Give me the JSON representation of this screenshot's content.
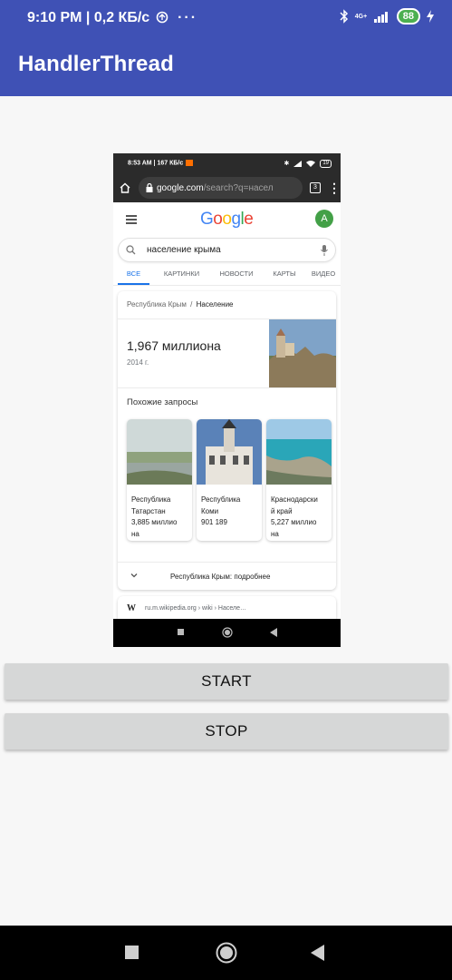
{
  "status_bar": {
    "time": "9:10 PM",
    "separator": "|",
    "speed": "0,2 КБ/с",
    "dots": "···",
    "network": "4G+",
    "battery": "88"
  },
  "app_bar": {
    "title": "HandlerThread"
  },
  "screenshot": {
    "status_bar": {
      "time": "8:53 AM",
      "speed": "167 КБ/с",
      "battery": "19"
    },
    "address_bar": {
      "domain": "google.com",
      "path": "/search?q=насел",
      "tabs_count": "3"
    },
    "google": {
      "logo_letters": [
        {
          "ch": "G",
          "color": "#4285f4"
        },
        {
          "ch": "o",
          "color": "#ea4335"
        },
        {
          "ch": "o",
          "color": "#fbbc05"
        },
        {
          "ch": "g",
          "color": "#4285f4"
        },
        {
          "ch": "l",
          "color": "#34a853"
        },
        {
          "ch": "e",
          "color": "#ea4335"
        }
      ],
      "avatar": "A",
      "query": "население крыма",
      "tabs": [
        "ВСЕ",
        "КАРТИНКИ",
        "НОВОСТИ",
        "КАРТЫ",
        "ВИДЕО"
      ],
      "active_tab": 0
    },
    "card": {
      "breadcrumb_parent": "Республика Крым",
      "breadcrumb_sep": "/",
      "breadcrumb_current": "Население",
      "population": "1,967 миллиона",
      "year": "2014 г.",
      "related_title": "Похожие запросы",
      "related": [
        {
          "l1": "Республика",
          "l2": "Татарстан",
          "l3": "3,885 миллио",
          "l4": "на"
        },
        {
          "l1": "Республика",
          "l2": "Коми",
          "l3": "901 189",
          "l4": ""
        },
        {
          "l1": "Краснодарски",
          "l2": "й край",
          "l3": "5,227 миллио",
          "l4": "на"
        }
      ],
      "more_label": "Республика Крым: подробнее"
    },
    "wiki": {
      "logo": "W",
      "url": "ru.m.wikipedia.org › wiki › Населе…"
    }
  },
  "buttons": {
    "start": "START",
    "stop": "STOP"
  },
  "colors": {
    "app_bar": "#3f51b5",
    "button": "#d6d7d7",
    "google_blue": "#1a73e8"
  }
}
